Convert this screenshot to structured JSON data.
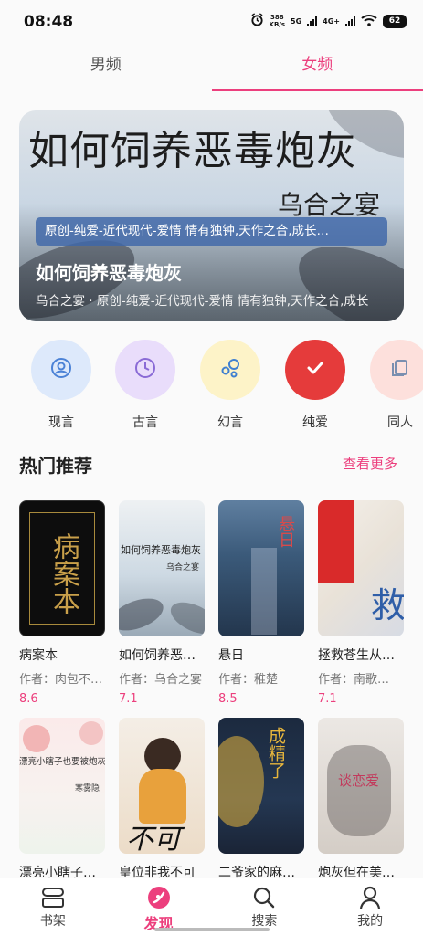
{
  "status": {
    "time": "08:48",
    "net_speed": "388",
    "net_unit": "KB/s",
    "sig1": "5G",
    "sig2": "4G+",
    "battery": "62"
  },
  "tabs": [
    {
      "label": "男频"
    },
    {
      "label": "女频"
    }
  ],
  "banner": {
    "cover_title": "如何饲养恶毒炮灰",
    "cover_author": "乌合之宴",
    "tags": "原创-纯爱-近代现代-爱情 情有独钟,天作之合,成长…",
    "name": "如何饲养恶毒炮灰",
    "desc": "乌合之宴 · 原创-纯爱-近代现代-爱情 情有独钟,天作之合,成长"
  },
  "categories": [
    {
      "label": "现言",
      "icon": "person-circle-icon",
      "bg": "#dde9fb",
      "fg": "#4b82d6"
    },
    {
      "label": "古言",
      "icon": "clock-icon",
      "bg": "#e9ddfb",
      "fg": "#8a6bd6"
    },
    {
      "label": "幻言",
      "icon": "bubbles-icon",
      "bg": "#fdf3c8",
      "fg": "#3f7fd0"
    },
    {
      "label": "纯爱",
      "icon": "check-icon",
      "bg": "#e53b3b",
      "fg": "#ffffff"
    },
    {
      "label": "同人",
      "icon": "pages-icon",
      "bg": "#fde0dc",
      "fg": "#7a8fb0"
    }
  ],
  "section": {
    "title": "热门推荐",
    "more": "查看更多"
  },
  "books": [
    {
      "title": "病案本",
      "author": "作者：肉包不吃肉",
      "score": "8.6",
      "cover_text": "病案本"
    },
    {
      "title": "如何饲养恶毒炮灰",
      "author": "作者：乌合之宴",
      "score": "7.1",
      "cover_text": "如何饲养恶毒炮灰",
      "cover_sub": "乌合之宴"
    },
    {
      "title": "悬日",
      "author": "作者：稚楚",
      "score": "8.5",
      "cover_text": "悬日"
    },
    {
      "title": "拯救苍生从…",
      "author": "作者：南歌…",
      "score": "7.1",
      "cover_text": "救"
    },
    {
      "title": "漂亮小瞎子也要被炮灰吗",
      "author": "",
      "score": "",
      "cover_text": "漂亮小瞎子也要被炮灰吗",
      "cover_sub": "寒雾隐"
    },
    {
      "title": "皇位非我不可",
      "author": "",
      "score": "",
      "cover_text": "不可"
    },
    {
      "title": "二爷家的麻…",
      "author": "",
      "score": "",
      "cover_text": "成精了"
    },
    {
      "title": "炮灰但在美…",
      "author": "",
      "score": "",
      "cover_text": "谈恋爱"
    }
  ],
  "nav": [
    {
      "label": "书架",
      "icon": "bookshelf-icon"
    },
    {
      "label": "发现",
      "icon": "discover-icon"
    },
    {
      "label": "搜索",
      "icon": "search-icon"
    },
    {
      "label": "我的",
      "icon": "profile-icon"
    }
  ],
  "colors": {
    "accent": "#ec3f7d",
    "score": "#ec3f7d"
  }
}
